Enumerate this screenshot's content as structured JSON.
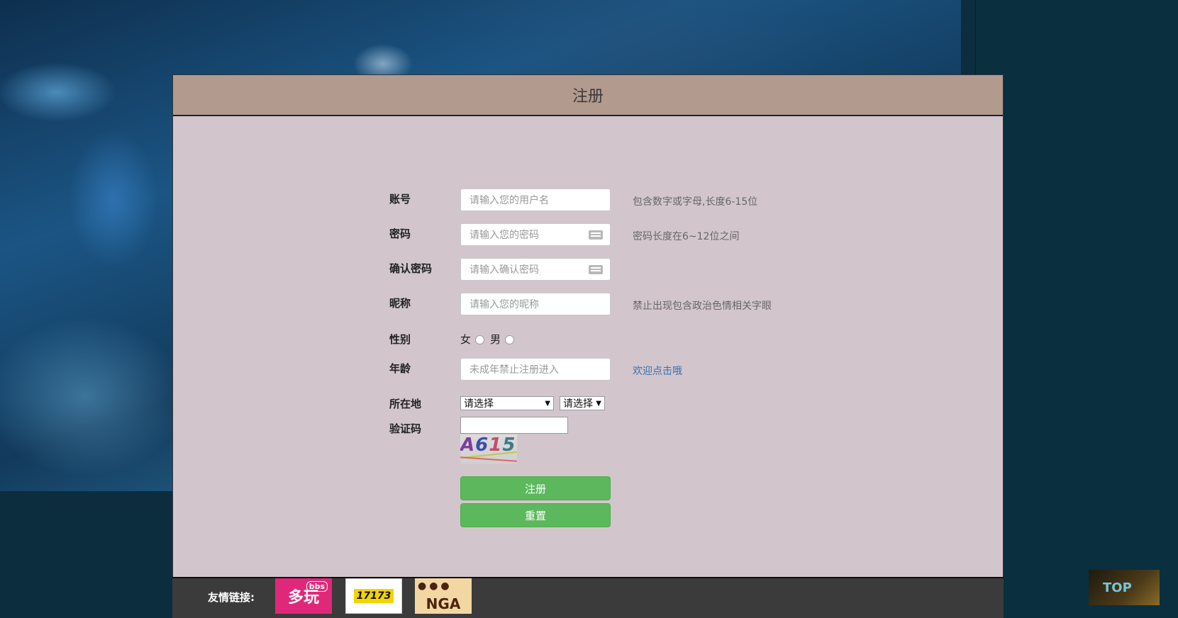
{
  "header": {
    "title": "注册"
  },
  "form": {
    "account": {
      "label": "账号",
      "placeholder": "请输入您的用户名",
      "hint": "包含数字或字母,长度6-15位"
    },
    "password": {
      "label": "密码",
      "placeholder": "请输入您的密码",
      "hint": "密码长度在6~12位之间"
    },
    "confirm": {
      "label": "确认密码",
      "placeholder": "请输入确认密码"
    },
    "nickname": {
      "label": "昵称",
      "placeholder": "请输入您的昵称",
      "hint": "禁止出现包含政治色情相关字眼"
    },
    "gender": {
      "label": "性别",
      "female": "女",
      "male": "男"
    },
    "age": {
      "label": "年龄",
      "placeholder": "未成年禁止注册进入",
      "hint": "欢迎点击哦"
    },
    "location": {
      "label": "所在地",
      "province": "请选择",
      "city": "请选择"
    },
    "captcha": {
      "label": "验证码",
      "chars": [
        "A",
        "6",
        "1",
        "5"
      ]
    },
    "submit_label": "注册",
    "reset_label": "重置"
  },
  "footer": {
    "links_label": "友情链接:",
    "logos": {
      "duowan": "多玩",
      "duowan_badge": "bbs",
      "s17173": "17173",
      "nga": "NGA"
    }
  },
  "top_button": {
    "label": "TOP"
  },
  "colors": {
    "header_bg": "#b29a8e",
    "panel_bg": "#d2c6cc",
    "button_green": "#5cb85c",
    "hint_link": "#3b6fb3"
  }
}
